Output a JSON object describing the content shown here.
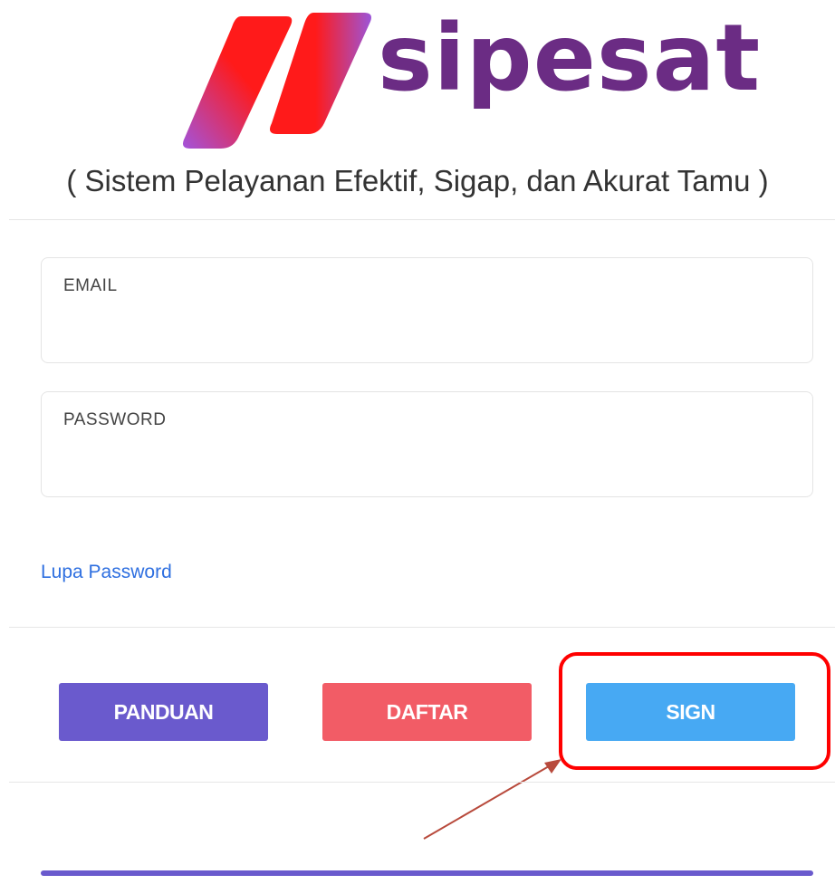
{
  "brand": {
    "name": "sipesat",
    "tagline": "( Sistem Pelayanan Efektif, Sigap, dan Akurat Tamu )",
    "colors": {
      "wordmark": "#6b2c84",
      "stripe_red": "#ff1a1a",
      "stripe_purple": "#a05ad8"
    }
  },
  "form": {
    "email": {
      "label": "EMAIL",
      "value": ""
    },
    "password": {
      "label": "PASSWORD",
      "value": ""
    },
    "forgot_link": "Lupa Password"
  },
  "actions": {
    "guide": {
      "label": "PANDUAN",
      "color": "#6a5acd"
    },
    "register": {
      "label": "DAFTAR",
      "color": "#f25c66"
    },
    "sign": {
      "label": "SIGN",
      "color": "#47a9f3"
    }
  },
  "annotation": {
    "highlight_color": "#ff0000",
    "arrow_color": "#b84a3c",
    "icon": "arrow-pointer"
  }
}
